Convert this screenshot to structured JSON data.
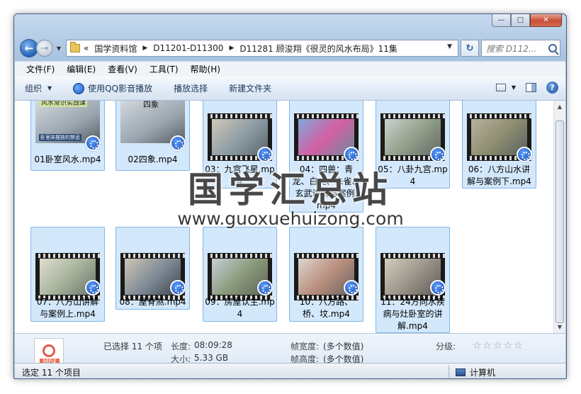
{
  "window": {
    "minimize_glyph": "—",
    "maximize_glyph": "□",
    "close_glyph": "✕"
  },
  "nav": {
    "back_glyph": "←",
    "forward_glyph": "→",
    "recent_glyph": "▼",
    "crumb_overflow": "«",
    "breadcrumbs": [
      "国学资料馆",
      "D11201-D11300",
      "D11281 顾浚翔《很灵的风水布局》11集"
    ],
    "refresh_glyph": "↻",
    "search_placeholder": "搜索 D112..."
  },
  "menu": [
    "文件(F)",
    "编辑(E)",
    "查看(V)",
    "工具(T)",
    "帮助(H)"
  ],
  "toolbar": {
    "organize": "组织",
    "play_qq": "使用QQ影音播放",
    "play_selection": "播放选择",
    "new_folder": "新建文件夹",
    "help_glyph": "?"
  },
  "files": [
    "01卧室风水.mp4",
    "02四象.mp4",
    "03：九宫飞星.mp4",
    "04：四兽：青龙、白虎、朱雀、玄武讲解与案例.mp4",
    "05：八卦九宫.mp4",
    "06：八方山水讲解与案例下.mp4",
    "07：八方山讲解与案例上.mp4",
    "08：屋脊煞.mp4",
    "09：房屋认主.mp4",
    "10：八方路、桥、坟.mp4",
    "11：24方向水疾病与灶卧室的讲解.mp4"
  ],
  "thumb_texts": {
    "file01_banner": "风水常识实战课",
    "file01_caption": "卧室床摆放的禁忌",
    "file02_banner": "四象"
  },
  "watermark": {
    "title": "国学汇总站",
    "url": "www.guoxuehuizong.com"
  },
  "details": {
    "icon_tag": "MP4",
    "selected": "已选择 11 个项",
    "length_label": "长度:",
    "length_value": "08:09:28",
    "size_label": "大小:",
    "size_value": "5.33 GB",
    "width_label": "帧宽度:",
    "width_value": "(多个数值)",
    "height_label": "帧高度:",
    "height_value": "(多个数值)",
    "rating_label": "分级:",
    "rating_stars": "☆☆☆☆☆"
  },
  "status": {
    "left": "选定 11 个项目",
    "right": "计算机"
  }
}
